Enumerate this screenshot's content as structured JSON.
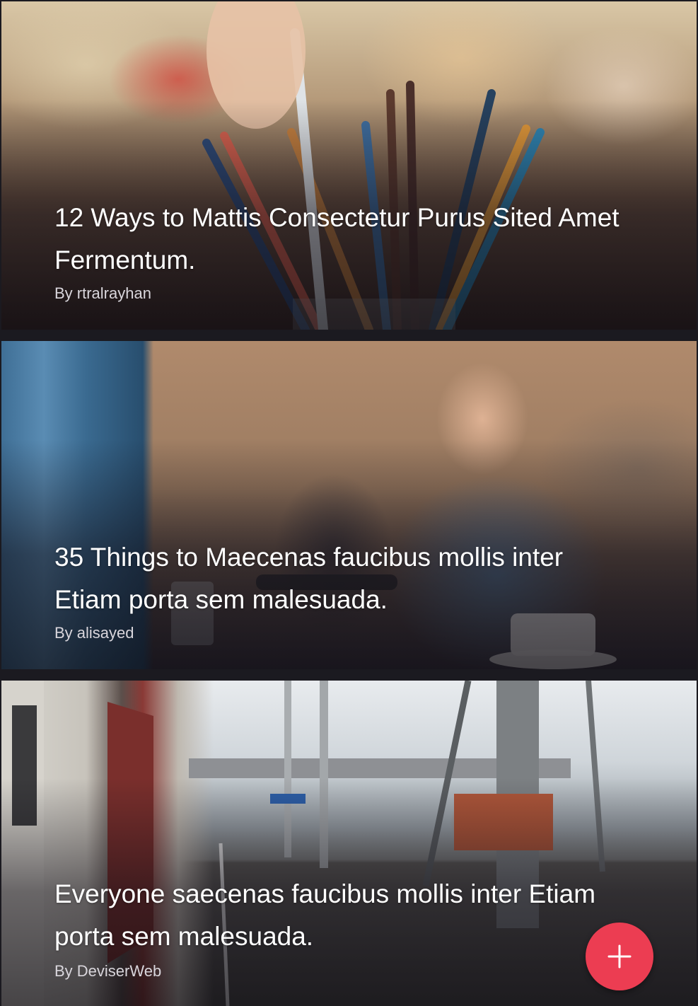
{
  "articles": [
    {
      "title": "12 Ways to Mattis Consectetur Purus Sited Amet Fermentum.",
      "author": "By rtralrayhan",
      "image": "pencils-in-cup-photo"
    },
    {
      "title": "35 Things to Maecenas faucibus mollis inter Etiam porta sem malesuada.",
      "author": "By alisayed",
      "image": "man-with-phone-cafe-photo"
    },
    {
      "title": "Everyone saecenas faucibus mollis inter Etiam porta sem malesuada.",
      "author": "By DeviserWeb",
      "image": "train-platform-photo"
    }
  ],
  "fab": {
    "icon": "plus-icon",
    "color": "#ec3d52"
  },
  "colors": {
    "background": "#1b1a20",
    "title_text": "#ffffff",
    "author_text": "#d9d6dc"
  }
}
